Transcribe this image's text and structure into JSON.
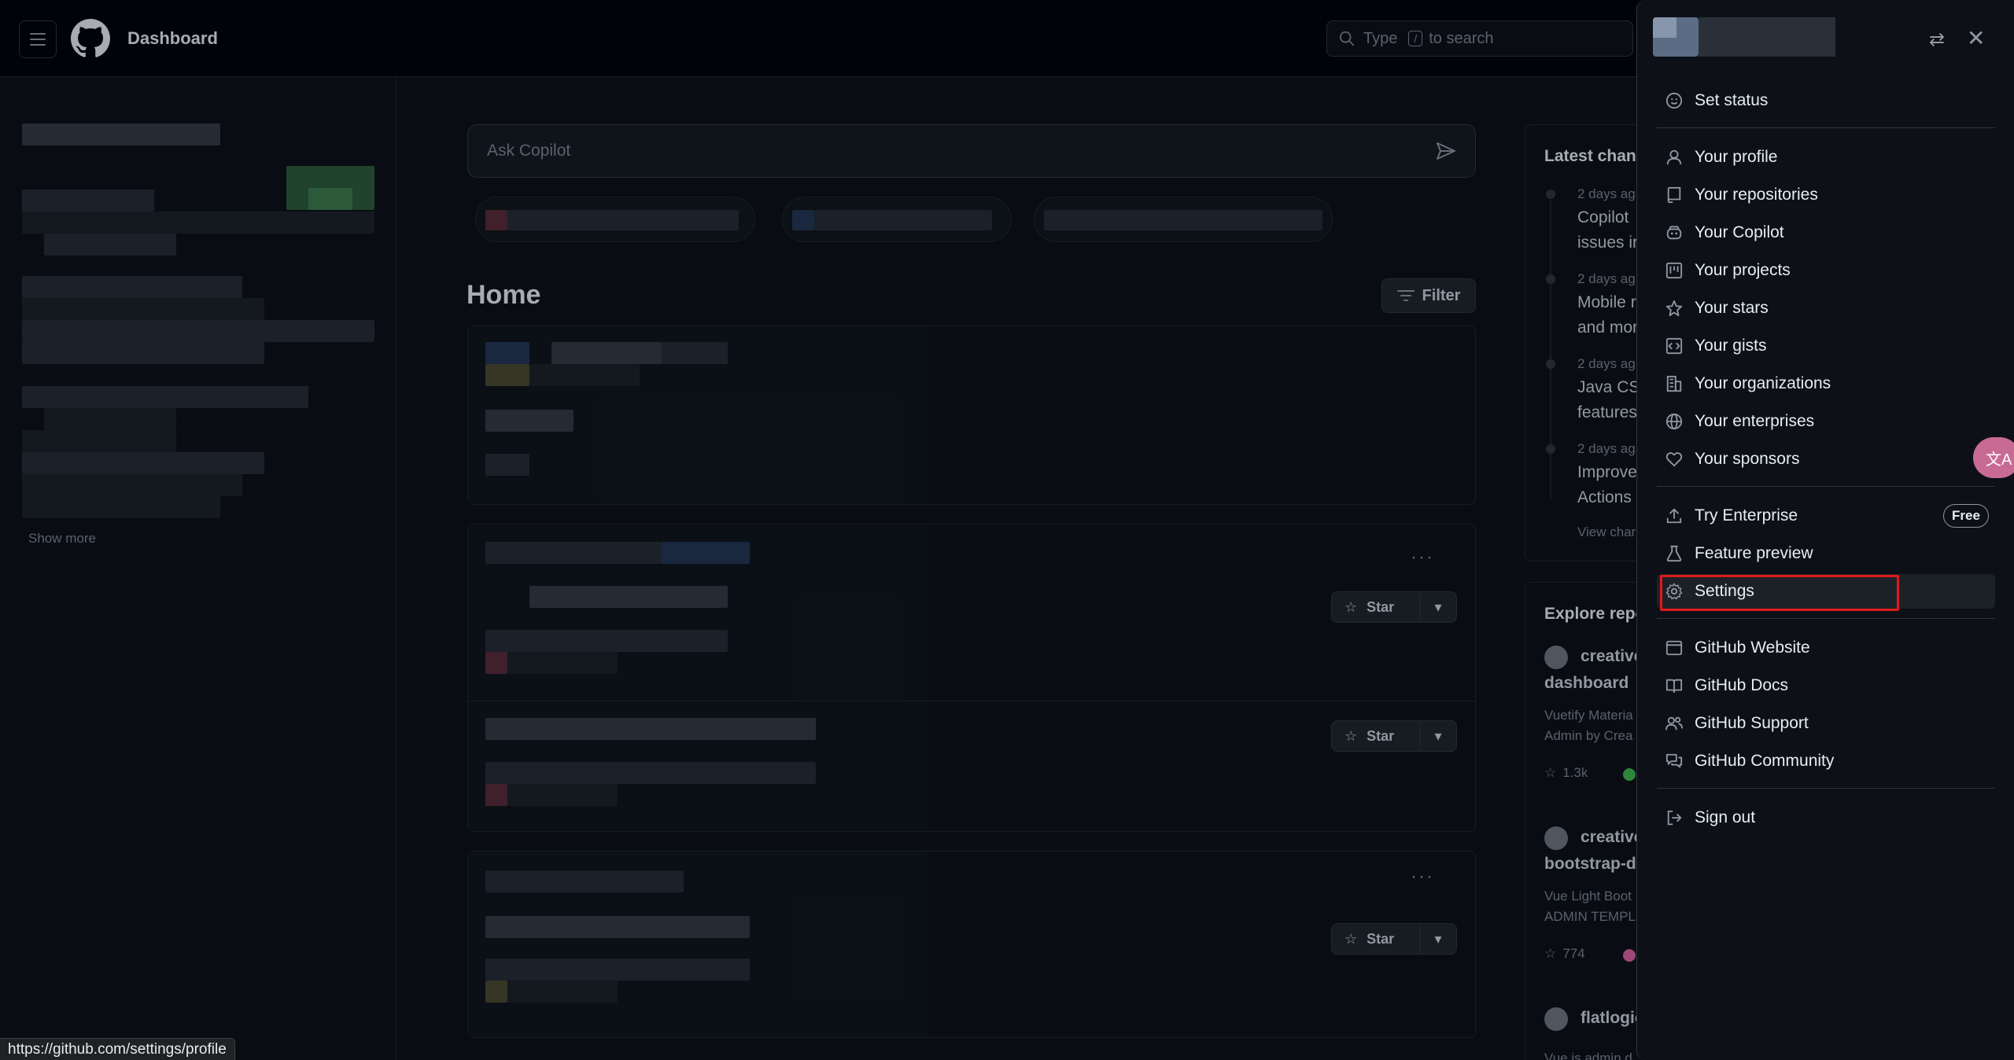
{
  "header": {
    "title": "Dashboard",
    "search_prefix": "Type",
    "search_key": "/",
    "search_suffix": "to search"
  },
  "sidebar": {
    "show_more": "Show more"
  },
  "main": {
    "copilot_placeholder": "Ask Copilot",
    "home_title": "Home",
    "filter_label": "Filter",
    "star_label": "Star"
  },
  "right_column": {
    "latest_changes_title": "Latest chang",
    "changes": [
      {
        "time": "2 days ag",
        "line1": "Copilot",
        "line2": "issues ir"
      },
      {
        "time": "2 days ag",
        "line1": "Mobile r",
        "line2": "and mor"
      },
      {
        "time": "2 days ag",
        "line1": "Java CSI",
        "line2": "features"
      },
      {
        "time": "2 days ag",
        "line1": "Improve",
        "line2": "Actions"
      }
    ],
    "view_changelog": "View char",
    "explore_title": "Explore repo",
    "repos": [
      {
        "owner": "creative",
        "name": "dashboard",
        "desc1": "Vuetify Materia",
        "desc2": "Admin by Crea",
        "stars": "1.3k",
        "lang_color": "#3fb950"
      },
      {
        "owner": "creative",
        "name": "bootstrap-da",
        "desc1": "Vue Light Boot",
        "desc2": "ADMIN TEMPL",
        "stars": "774",
        "lang_color": "#db61a2"
      },
      {
        "owner": "flatlogic",
        "name": "",
        "desc1": "Vue is admin d",
        "desc2": "",
        "stars": "",
        "lang_color": ""
      }
    ]
  },
  "user_menu": {
    "items": [
      {
        "label": "Set status",
        "icon": "smiley-icon"
      },
      {
        "label": "Your profile",
        "icon": "person-icon"
      },
      {
        "label": "Your repositories",
        "icon": "repo-icon"
      },
      {
        "label": "Your Copilot",
        "icon": "copilot-icon"
      },
      {
        "label": "Your projects",
        "icon": "project-icon"
      },
      {
        "label": "Your stars",
        "icon": "star-icon"
      },
      {
        "label": "Your gists",
        "icon": "code-square-icon"
      },
      {
        "label": "Your organizations",
        "icon": "organization-icon"
      },
      {
        "label": "Your enterprises",
        "icon": "globe-icon"
      },
      {
        "label": "Your sponsors",
        "icon": "heart-icon"
      },
      {
        "label": "Try Enterprise",
        "icon": "upload-icon"
      },
      {
        "label": "Feature preview",
        "icon": "beaker-icon"
      },
      {
        "label": "Settings",
        "icon": "gear-icon"
      },
      {
        "label": "GitHub Website",
        "icon": "browser-icon"
      },
      {
        "label": "GitHub Docs",
        "icon": "book-icon"
      },
      {
        "label": "GitHub Support",
        "icon": "people-icon"
      },
      {
        "label": "GitHub Community",
        "icon": "comment-discussion-icon"
      },
      {
        "label": "Sign out",
        "icon": "sign-out-icon"
      }
    ],
    "free_badge": "Free"
  },
  "status_bar": {
    "url": "https://github.com/settings/profile"
  },
  "colors": {
    "highlight": "#e0191b",
    "background": "#0d1117",
    "translate_button": "#c86b94"
  }
}
